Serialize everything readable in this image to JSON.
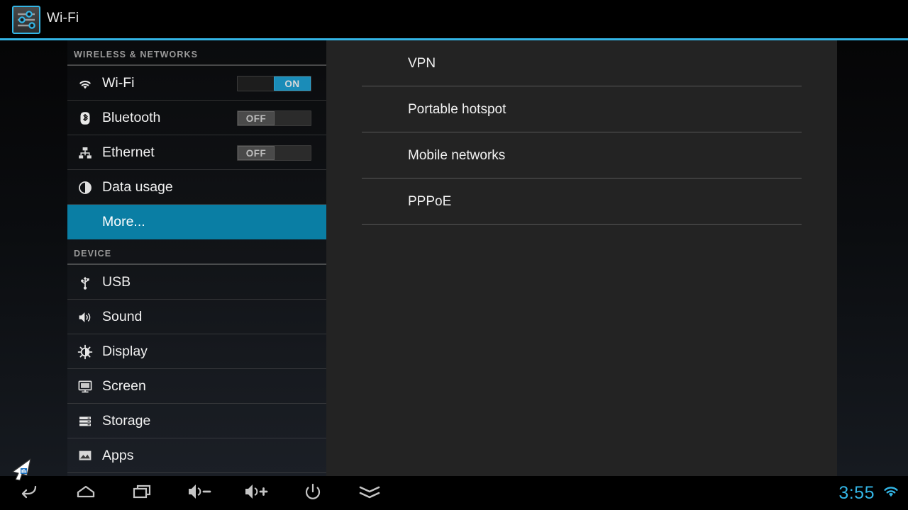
{
  "titlebar": {
    "title": "Wi-Fi",
    "icon": "settings-sliders-icon",
    "accent_color": "#33b5e5"
  },
  "sidebar": {
    "sections": [
      {
        "header": "WIRELESS & NETWORKS",
        "items": [
          {
            "label": "Wi-Fi",
            "icon": "wifi-icon",
            "toggle": "ON",
            "selected": false
          },
          {
            "label": "Bluetooth",
            "icon": "bluetooth-icon",
            "toggle": "OFF",
            "selected": false
          },
          {
            "label": "Ethernet",
            "icon": "ethernet-icon",
            "toggle": "OFF",
            "selected": false
          },
          {
            "label": "Data usage",
            "icon": "data-usage-icon",
            "toggle": "",
            "selected": false
          },
          {
            "label": "More...",
            "icon": "",
            "toggle": "",
            "selected": true
          }
        ]
      },
      {
        "header": "DEVICE",
        "items": [
          {
            "label": "USB",
            "icon": "usb-icon",
            "toggle": "",
            "selected": false
          },
          {
            "label": "Sound",
            "icon": "sound-icon",
            "toggle": "",
            "selected": false
          },
          {
            "label": "Display",
            "icon": "display-icon",
            "toggle": "",
            "selected": false
          },
          {
            "label": "Screen",
            "icon": "screen-icon",
            "toggle": "",
            "selected": false
          },
          {
            "label": "Storage",
            "icon": "storage-icon",
            "toggle": "",
            "selected": false
          },
          {
            "label": "Apps",
            "icon": "apps-icon",
            "toggle": "",
            "selected": false
          }
        ]
      }
    ],
    "selected_color": "#0a7ea4"
  },
  "content": {
    "items": [
      {
        "label": "VPN"
      },
      {
        "label": "Portable hotspot"
      },
      {
        "label": "Mobile networks"
      },
      {
        "label": "PPPoE"
      }
    ]
  },
  "navbar": {
    "buttons": [
      {
        "icon": "back-icon",
        "name": "nav-back"
      },
      {
        "icon": "home-icon",
        "name": "nav-home"
      },
      {
        "icon": "recents-icon",
        "name": "nav-recents"
      },
      {
        "icon": "volume-down-icon",
        "name": "nav-volume-down"
      },
      {
        "icon": "volume-up-icon",
        "name": "nav-volume-up"
      },
      {
        "icon": "power-icon",
        "name": "nav-power"
      },
      {
        "icon": "collapse-down-icon",
        "name": "nav-collapse"
      }
    ],
    "clock": "3:55",
    "status_icon": "wifi-status-icon",
    "clock_color": "#33b5e5"
  },
  "cursor": {
    "icon": "mouse-pointer-icon"
  }
}
